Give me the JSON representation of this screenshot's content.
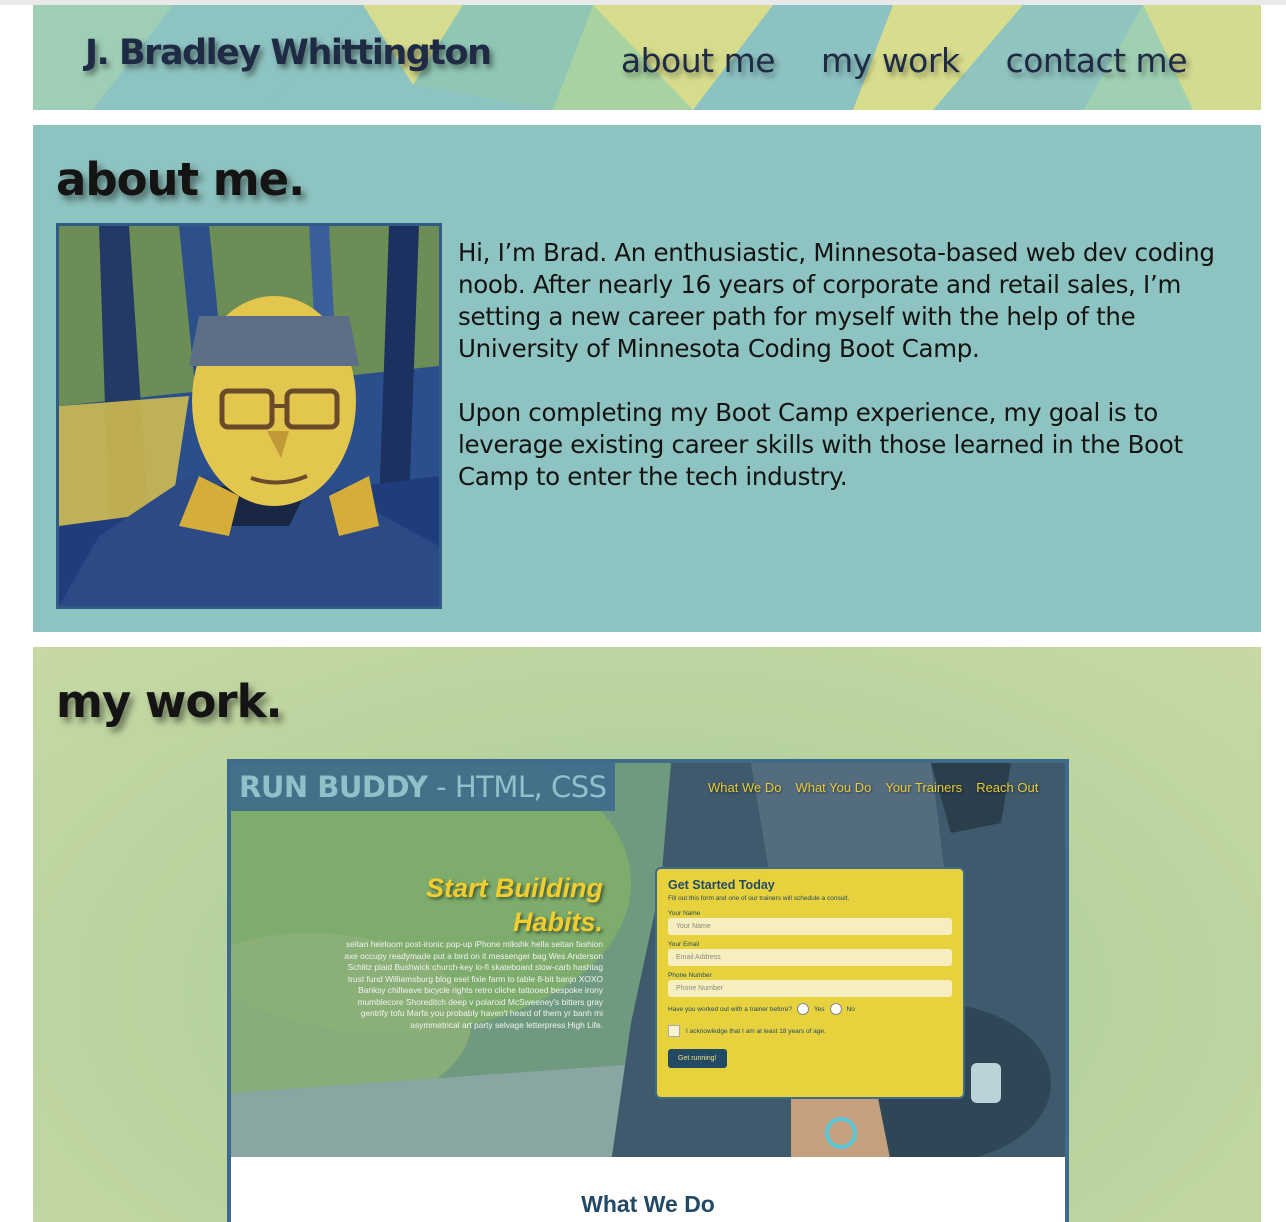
{
  "header": {
    "brand": "J. Bradley Whittington",
    "nav": [
      "about me",
      "my work",
      "contact me"
    ]
  },
  "about": {
    "title": "about me.",
    "paragraphs": [
      "Hi, I’m Brad. An enthusiastic, Minnesota-based web dev coding noob. After nearly 16 years of corporate and retail sales, I’m setting a new career path for myself with the help of the University of Minnesota Coding Boot Camp.",
      "Upon completing my Boot Camp experience, my goal is to leverage existing career skills with those learned in the Boot Camp to enter the tech industry."
    ]
  },
  "work": {
    "title": "my work.",
    "project": {
      "name": "RUN BUDDY",
      "separator": " - ",
      "tech": "HTML, CSS",
      "nav": [
        "What We Do",
        "What You Do",
        "Your Trainers",
        "Reach Out"
      ],
      "headline_1": "Start Building",
      "headline_2": "Habits.",
      "blurb": "seitan heirloom post-ironic pop-up iPhone mlkshk hella seitan fashion axe occupy readymade put a bird on it messenger bag Wes Anderson Schlitz plaid Bushwick church-key lo-fi skateboard slow-carb hashtag trust fund Williamsburg blog esel fixie farm to table 8-bit banjo XOXO Banksy chillwave bicycle rights retro cliche tattooed bespoke irony mumblecore Shoreditch deep v polaroid McSweeney's bitters gray gentrify tofu Marfa you probably haven't heard of them yr banh mi asymmetrical art party selvage letterpress High Life.",
      "form": {
        "title": "Get Started Today",
        "subtitle": "Fill out this form and one of our trainers will schedule a consult.",
        "name_label": "Your Name",
        "name_placeholder": "Your Name",
        "email_label": "Your Email",
        "email_placeholder": "Email Address",
        "phone_label": "Phone Number",
        "phone_placeholder": "Phone Number",
        "radio_question": "Have you worked out with a trainer before?",
        "radio_yes": "Yes",
        "radio_no": "No",
        "checkbox_label": "I acknowledge that I am at least 18 years of age.",
        "button": "Get running!"
      },
      "section_heading": "What We Do"
    }
  },
  "colors": {
    "teal": "#8dc3c0",
    "green": "#b8d39e",
    "navy": "#1f2a44",
    "project_border": "#3e6b8c",
    "yellow": "#e7d23d"
  }
}
